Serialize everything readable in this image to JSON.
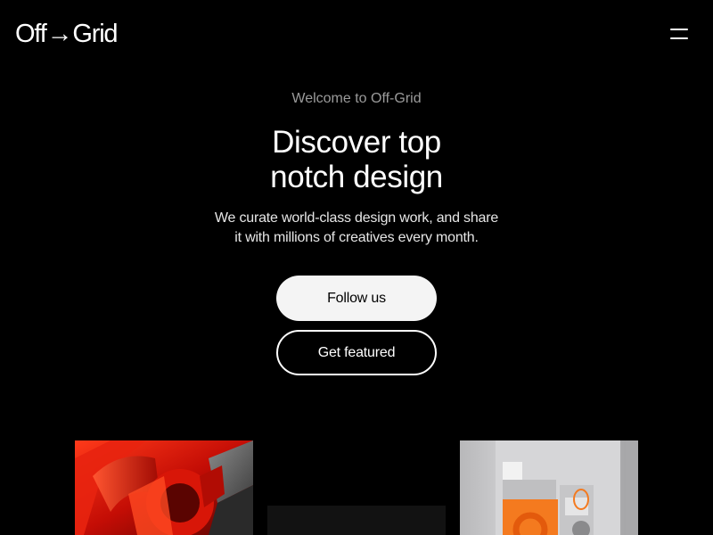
{
  "brand": {
    "logo_text_left": "Off",
    "logo_arrow": "→",
    "logo_text_right": "Grid"
  },
  "header": {
    "menu_icon": "hamburger-menu-icon"
  },
  "hero": {
    "eyebrow": "Welcome to Off-Grid",
    "title_line_1": "Discover top",
    "title_line_2": "notch design",
    "subtitle_line_1": "We curate world-class design work, and share",
    "subtitle_line_2": "it with millions of creatives every month.",
    "primary_button": "Follow us",
    "secondary_button": "Get featured"
  },
  "gallery": {
    "items": [
      {
        "kind": "abstract-red-3d-render"
      },
      {
        "kind": "dark-image"
      },
      {
        "kind": "orange-product-render"
      }
    ]
  },
  "colors": {
    "background": "#000000",
    "text": "#ffffff",
    "muted_text": "#9b9b9b",
    "primary_button_bg": "#f4f4f4",
    "primary_button_text": "#000000",
    "accent_red": "#e01b0c",
    "accent_orange": "#f47a1f"
  }
}
